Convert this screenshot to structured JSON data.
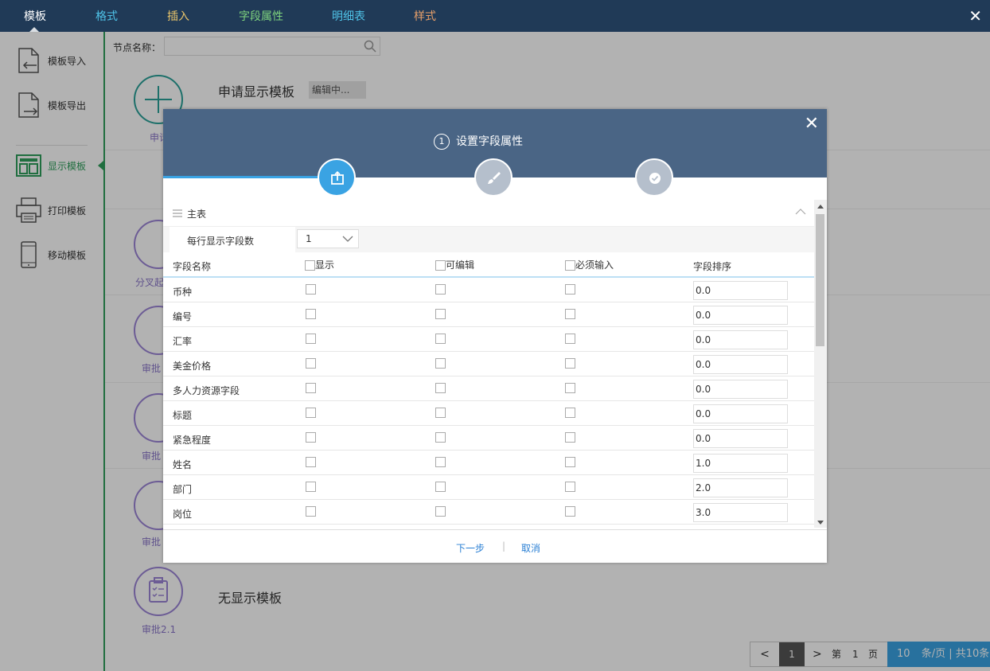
{
  "topbar": {
    "tabs": [
      {
        "label": "模板",
        "color": "#ffffff"
      },
      {
        "label": "格式",
        "color": "#4fc3e8"
      },
      {
        "label": "插入",
        "color": "#e8c46a"
      },
      {
        "label": "字段属性",
        "color": "#7ed37e"
      },
      {
        "label": "明细表",
        "color": "#4fc3e8"
      },
      {
        "label": "样式",
        "color": "#e8a06a"
      }
    ]
  },
  "sidebar": {
    "items": [
      {
        "label": "模板导入",
        "icon": "template-import-icon"
      },
      {
        "label": "模板导出",
        "icon": "template-export-icon"
      },
      {
        "label": "显示模板",
        "icon": "display-template-icon"
      },
      {
        "label": "打印模板",
        "icon": "printer-icon"
      },
      {
        "label": "移动模板",
        "icon": "mobile-icon"
      }
    ]
  },
  "main": {
    "search_label": "节点名称：",
    "template_title": "申请显示模板",
    "edit_badge": "编辑中...",
    "nodes": [
      "申请",
      "分叉起",
      "审批",
      "审批",
      "审批",
      "审批2.1"
    ],
    "no_template": "无显示模板"
  },
  "pager": {
    "prev": "<",
    "current": "1",
    "next": ">",
    "page_prefix": "第",
    "page_num": "1",
    "page_suffix": "页",
    "size": "10",
    "size_text": "条/页 | 共10条"
  },
  "modal": {
    "step_number": "1",
    "step_title": "设置字段属性",
    "section_title": "主表",
    "per_row_label": "每行显示字段数",
    "per_row_value": "1",
    "columns": {
      "name": "字段名称",
      "show": "显示",
      "editable": "可编辑",
      "required": "必须输入",
      "order": "字段排序"
    },
    "rows": [
      {
        "name": "币种",
        "order": "0.0"
      },
      {
        "name": "编号",
        "order": "0.0"
      },
      {
        "name": "汇率",
        "order": "0.0"
      },
      {
        "name": "美金价格",
        "order": "0.0"
      },
      {
        "name": "多人力资源字段",
        "order": "0.0"
      },
      {
        "name": "标题",
        "order": "0.0"
      },
      {
        "name": "紧急程度",
        "order": "0.0"
      },
      {
        "name": "姓名",
        "order": "1.0"
      },
      {
        "name": "部门",
        "order": "2.0"
      },
      {
        "name": "岗位",
        "order": "3.0"
      }
    ],
    "next_label": "下一步",
    "separator": "|",
    "cancel_label": "取消"
  }
}
